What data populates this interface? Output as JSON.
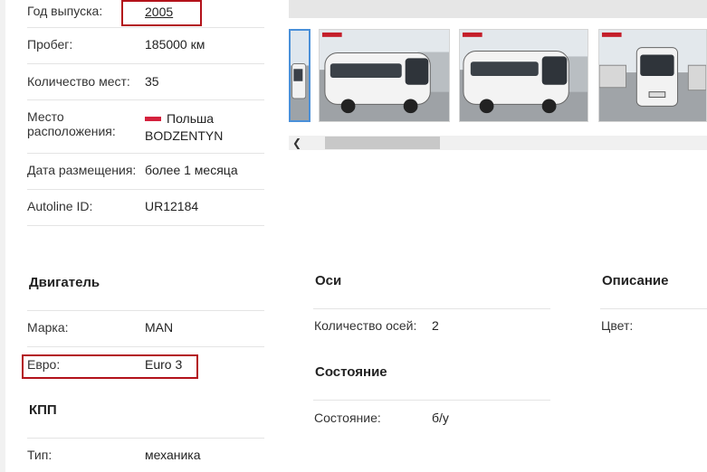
{
  "specs": {
    "year": {
      "label": "Год выпуска:",
      "value": "2005"
    },
    "mileage": {
      "label": "Пробег:",
      "value": "185000 км"
    },
    "seats": {
      "label": "Количество мест:",
      "value": "35"
    },
    "location": {
      "label_line1": "Место",
      "label_line2": "расположения:",
      "country": "Польша",
      "city": "BODZENTYN"
    },
    "posted": {
      "label": "Дата размещения:",
      "value": "более 1 месяца"
    },
    "autoline_id": {
      "label": "Autoline ID:",
      "value": "UR12184"
    }
  },
  "engine": {
    "title": "Двигатель",
    "brand": {
      "label": "Марка:",
      "value": "MAN"
    },
    "euro": {
      "label": "Евро:",
      "value": "Euro 3"
    }
  },
  "gearbox": {
    "title": "КПП",
    "type": {
      "label": "Тип:",
      "value": "механика"
    }
  },
  "axles": {
    "title": "Оси",
    "count": {
      "label": "Количество осей:",
      "value": "2"
    }
  },
  "condition": {
    "title": "Состояние",
    "state": {
      "label": "Состояние:",
      "value": "б/у"
    }
  },
  "description": {
    "title": "Описание",
    "color": {
      "label": "Цвет:"
    }
  },
  "gallery": {
    "scroll_left_icon": "chevron-left-icon",
    "thumbnails": [
      "bus-photo-1",
      "bus-photo-2",
      "bus-photo-3",
      "bus-photo-4"
    ]
  },
  "colors": {
    "highlight": "#b3121a",
    "flag": "#d4213d",
    "selected": "#4a90d9"
  }
}
